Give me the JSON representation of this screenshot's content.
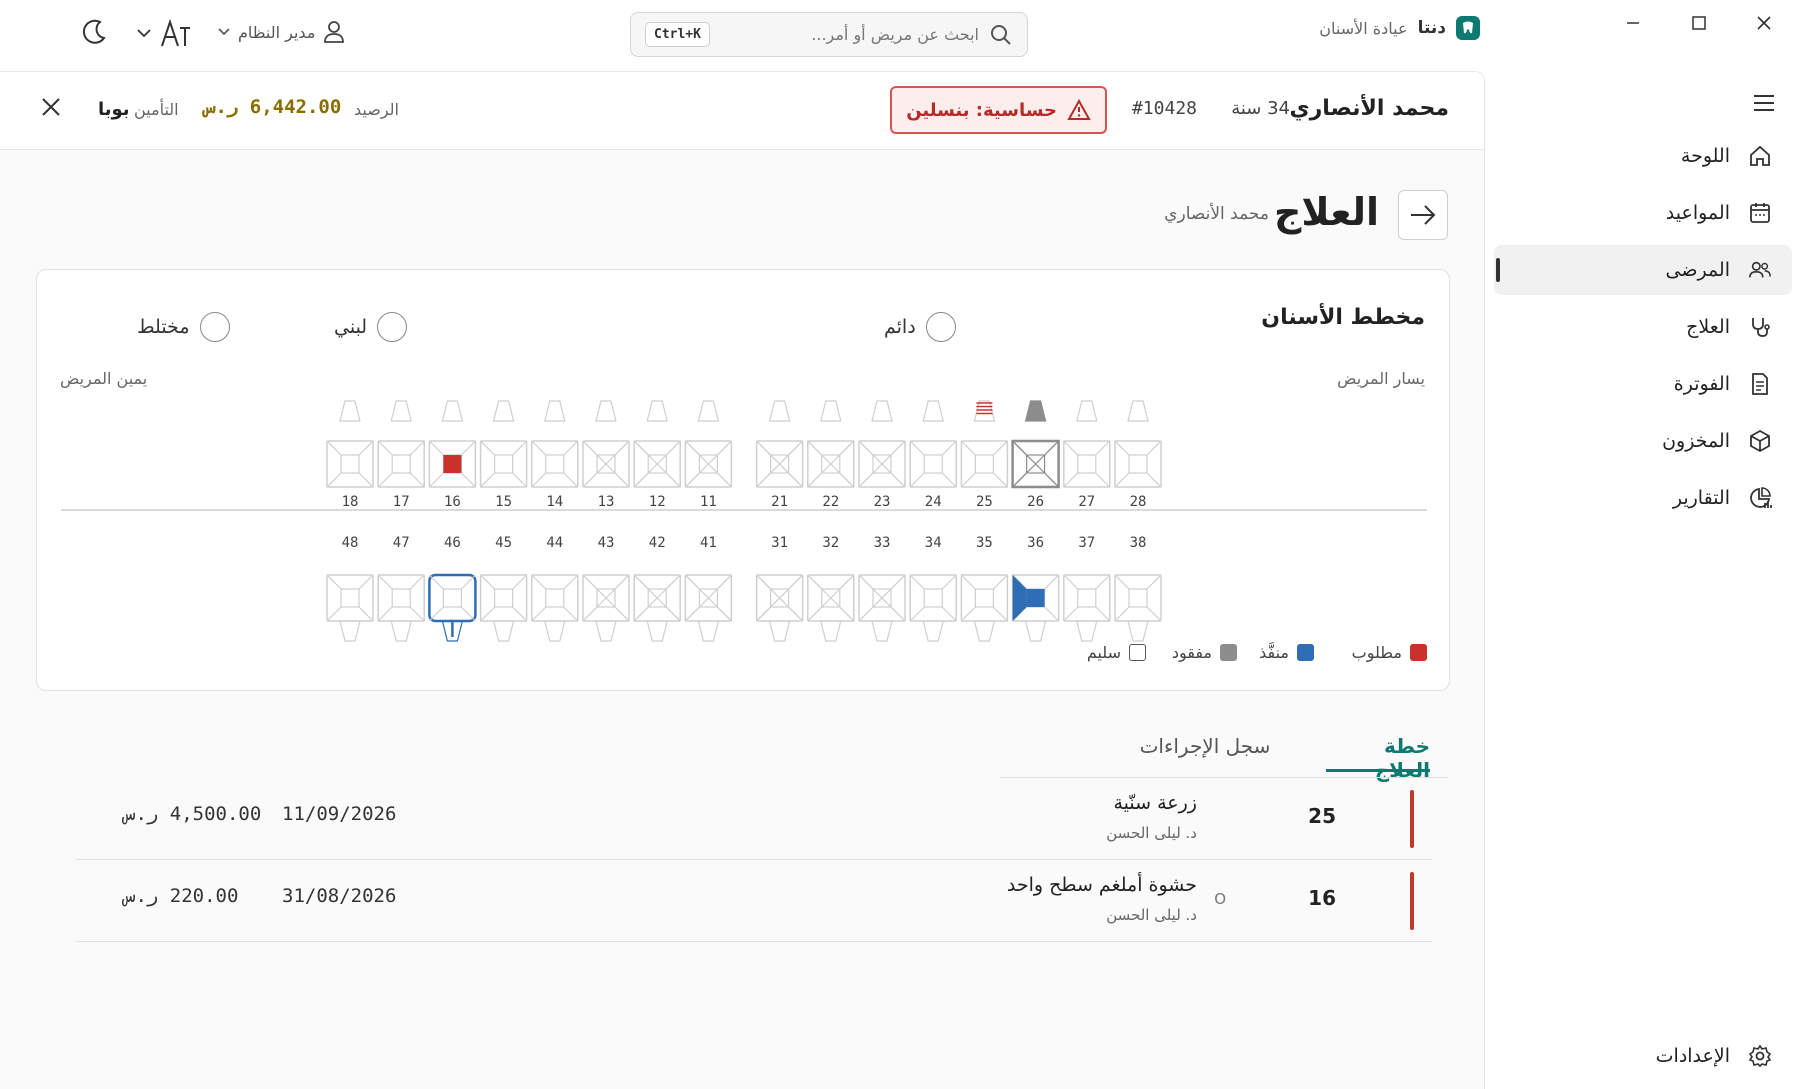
{
  "app": {
    "name": "دنتا",
    "subtitle": "عيادة الأسنان"
  },
  "search": {
    "placeholder": "ابحث عن مريض أو أمر...",
    "shortcut": "Ctrl+K"
  },
  "user": {
    "name": "مدير النظام"
  },
  "sidebar": {
    "items": [
      {
        "label": "اللوحة",
        "icon": "home-icon"
      },
      {
        "label": "المواعيد",
        "icon": "calendar-icon"
      },
      {
        "label": "المرضى",
        "icon": "users-icon",
        "active": true
      },
      {
        "label": "العلاج",
        "icon": "stethoscope-icon"
      },
      {
        "label": "الفوترة",
        "icon": "receipt-icon"
      },
      {
        "label": "المخزون",
        "icon": "box-icon"
      },
      {
        "label": "التقارير",
        "icon": "chart-icon"
      }
    ],
    "settings_label": "الإعدادات"
  },
  "patient": {
    "name": "محمد الأنصاري",
    "age": "34 سنة",
    "id": "#10428",
    "allergy": "حساسية: بنسلين",
    "balance_label": "الرصيد",
    "balance": "6,442.00 ر.س",
    "insurance_label": "التأمين",
    "insurance": "بوبا"
  },
  "page": {
    "title": "العلاج",
    "subtitle": "محمد الأنصاري"
  },
  "dental_chart": {
    "title": "مخطط الأسنان",
    "dentition_options": [
      "دائم",
      "لبني",
      "مختلط"
    ],
    "patient_left_label": "يسار المريض",
    "patient_right_label": "يمين المريض",
    "upper_teeth": [
      "18",
      "17",
      "16",
      "15",
      "14",
      "13",
      "12",
      "11",
      "21",
      "22",
      "23",
      "24",
      "25",
      "26",
      "27",
      "28"
    ],
    "lower_teeth": [
      "48",
      "47",
      "46",
      "45",
      "44",
      "43",
      "42",
      "41",
      "31",
      "32",
      "33",
      "34",
      "35",
      "36",
      "37",
      "38"
    ],
    "status": {
      "16": "required",
      "25": "required-crown",
      "26": "missing",
      "36": "done",
      "46": "selected",
      "11": "crossed",
      "12": "crossed",
      "13": "crossed",
      "21": "crossed",
      "22": "crossed",
      "23": "crossed",
      "41": "crossed",
      "42": "crossed",
      "43": "crossed",
      "31": "crossed",
      "32": "crossed",
      "33": "crossed"
    },
    "legend": [
      {
        "label": "مطلوب",
        "color": "#c8322b"
      },
      {
        "label": "منفَّذ",
        "color": "#2f6db5"
      },
      {
        "label": "مفقود",
        "color": "#8d8d8d"
      },
      {
        "label": "سليم",
        "color": "#ffffff"
      }
    ]
  },
  "tabs": [
    {
      "label": "خطة العلاج",
      "active": true
    },
    {
      "label": "سجل الإجراءات",
      "active": false
    }
  ],
  "treatments": [
    {
      "tooth": "25",
      "name": "زرعة سنّية",
      "doctor": "د. ليلى الحسن",
      "count": "",
      "date": "11/09/2026",
      "price": "4,500.00 ر.س"
    },
    {
      "tooth": "16",
      "name": "حشوة أملغم سطح واحد",
      "doctor": "د. ليلى الحسن",
      "count": "O",
      "date": "31/08/2026",
      "price": "220.00 ر.س"
    }
  ],
  "colors": {
    "accent": "#0d7a72",
    "required": "#c8322b",
    "done": "#2f6db5",
    "missing": "#8d8d8d",
    "allergy": "#d9534f"
  }
}
